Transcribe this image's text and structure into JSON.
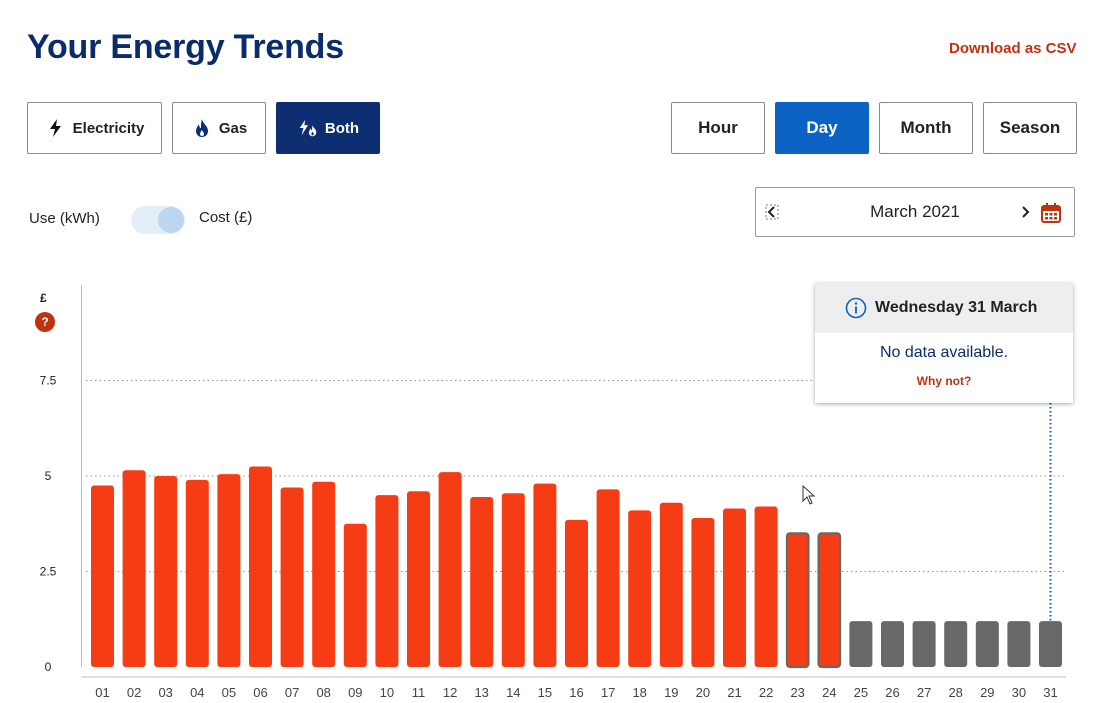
{
  "page": {
    "title": "Your Energy Trends",
    "download_label": "Download as CSV"
  },
  "fuel_buttons": [
    {
      "label": "Electricity",
      "icon": "lightning-icon",
      "active": false
    },
    {
      "label": "Gas",
      "icon": "flame-icon",
      "active": false
    },
    {
      "label": "Both",
      "icon": "lightning-flame-icon",
      "active": true
    }
  ],
  "period_buttons": [
    {
      "label": "Hour",
      "active": false
    },
    {
      "label": "Day",
      "active": true
    },
    {
      "label": "Month",
      "active": false
    },
    {
      "label": "Season",
      "active": false
    }
  ],
  "toggle": {
    "left_label": "Use (kWh)",
    "right_label": "Cost (£)",
    "selected": "Cost (£)"
  },
  "date_picker": {
    "label": "March 2021"
  },
  "tooltip": {
    "date": "Wednesday 31 March",
    "message": "No data available.",
    "link": "Why not?"
  },
  "help_badge": "?",
  "colors": {
    "actual_bar": "#f53c14",
    "estimated_bar": "#686868",
    "brand_navy": "#0d2f71",
    "active_blue": "#0b63c4",
    "accent_red": "#c0320f"
  },
  "chart_data": {
    "type": "bar",
    "ylabel": "£",
    "ylim": [
      0,
      8.5
    ],
    "yticks": [
      0,
      2.5,
      5,
      7.5
    ],
    "ytick_labels": [
      "0",
      "2.5",
      "5",
      "7.5"
    ],
    "grid": true,
    "categories": [
      "01",
      "02",
      "03",
      "04",
      "05",
      "06",
      "07",
      "08",
      "09",
      "10",
      "11",
      "12",
      "13",
      "14",
      "15",
      "16",
      "17",
      "18",
      "19",
      "20",
      "21",
      "22",
      "23",
      "24",
      "25",
      "26",
      "27",
      "28",
      "29",
      "30",
      "31"
    ],
    "values": [
      4.75,
      5.15,
      5.0,
      4.9,
      5.05,
      5.25,
      4.7,
      4.85,
      3.75,
      4.5,
      4.6,
      5.1,
      4.45,
      4.55,
      4.8,
      3.85,
      4.65,
      4.1,
      4.3,
      3.9,
      4.15,
      4.2,
      3.5,
      3.5,
      1.2,
      1.2,
      1.2,
      1.2,
      1.2,
      1.2,
      1.2
    ],
    "bar_status": [
      "actual",
      "actual",
      "actual",
      "actual",
      "actual",
      "actual",
      "actual",
      "actual",
      "actual",
      "actual",
      "actual",
      "actual",
      "actual",
      "actual",
      "actual",
      "actual",
      "actual",
      "actual",
      "actual",
      "actual",
      "actual",
      "actual",
      "outlined",
      "outlined",
      "nodata",
      "nodata",
      "nodata",
      "nodata",
      "nodata",
      "nodata",
      "nodata"
    ],
    "selected_category": "31"
  }
}
